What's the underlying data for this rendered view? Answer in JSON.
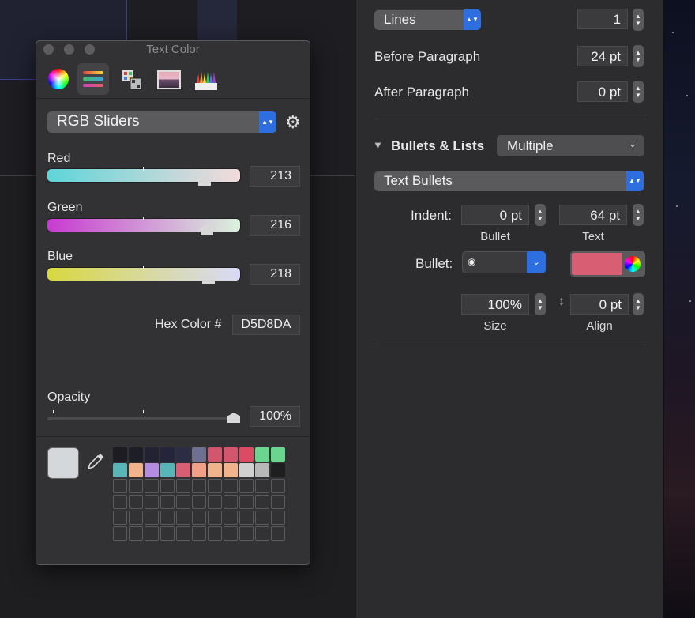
{
  "inspector": {
    "spacing_popup": "Lines",
    "spacing_value": "1",
    "before_paragraph_label": "Before Paragraph",
    "before_paragraph_value": "24 pt",
    "after_paragraph_label": "After Paragraph",
    "after_paragraph_value": "0 pt",
    "bullets_section_label": "Bullets & Lists",
    "bullets_style_popup": "Multiple",
    "bullet_type_popup": "Text Bullets",
    "indent_label": "Indent:",
    "indent_bullet_value": "0 pt",
    "indent_text_value": "64 pt",
    "indent_bullet_caption": "Bullet",
    "indent_text_caption": "Text",
    "bullet_label": "Bullet:",
    "bullet_glyph": "◉",
    "bullet_color": "#d85e74",
    "size_value": "100%",
    "size_caption": "Size",
    "align_value": "0 pt",
    "align_caption": "Align"
  },
  "color_panel": {
    "title": "Text Color",
    "mode_popup": "RGB Sliders",
    "sliders": [
      {
        "label": "Red",
        "value": "213"
      },
      {
        "label": "Green",
        "value": "216"
      },
      {
        "label": "Blue",
        "value": "218"
      }
    ],
    "hex_label": "Hex Color #",
    "hex_value": "D5D8DA",
    "opacity_label": "Opacity",
    "opacity_value": "100%",
    "current_color": "#d5d8da",
    "swatch_rows": [
      [
        "#1c1c22",
        "#1e1e26",
        "#222232",
        "#24243a",
        "#2c2c44",
        "#6e7090",
        "#d4566e",
        "#d4566e",
        "#dc4a64",
        "#6bd48e",
        "#6bd48e"
      ],
      [
        "#58b6b8",
        "#f0b48c",
        "#b48ce0",
        "#58b6b8",
        "#d85e74",
        "#f0a088",
        "#f0b48c",
        "#f0b48c",
        "#d0d0d0",
        "#b8b8b8",
        "#1e1e1e"
      ]
    ]
  }
}
